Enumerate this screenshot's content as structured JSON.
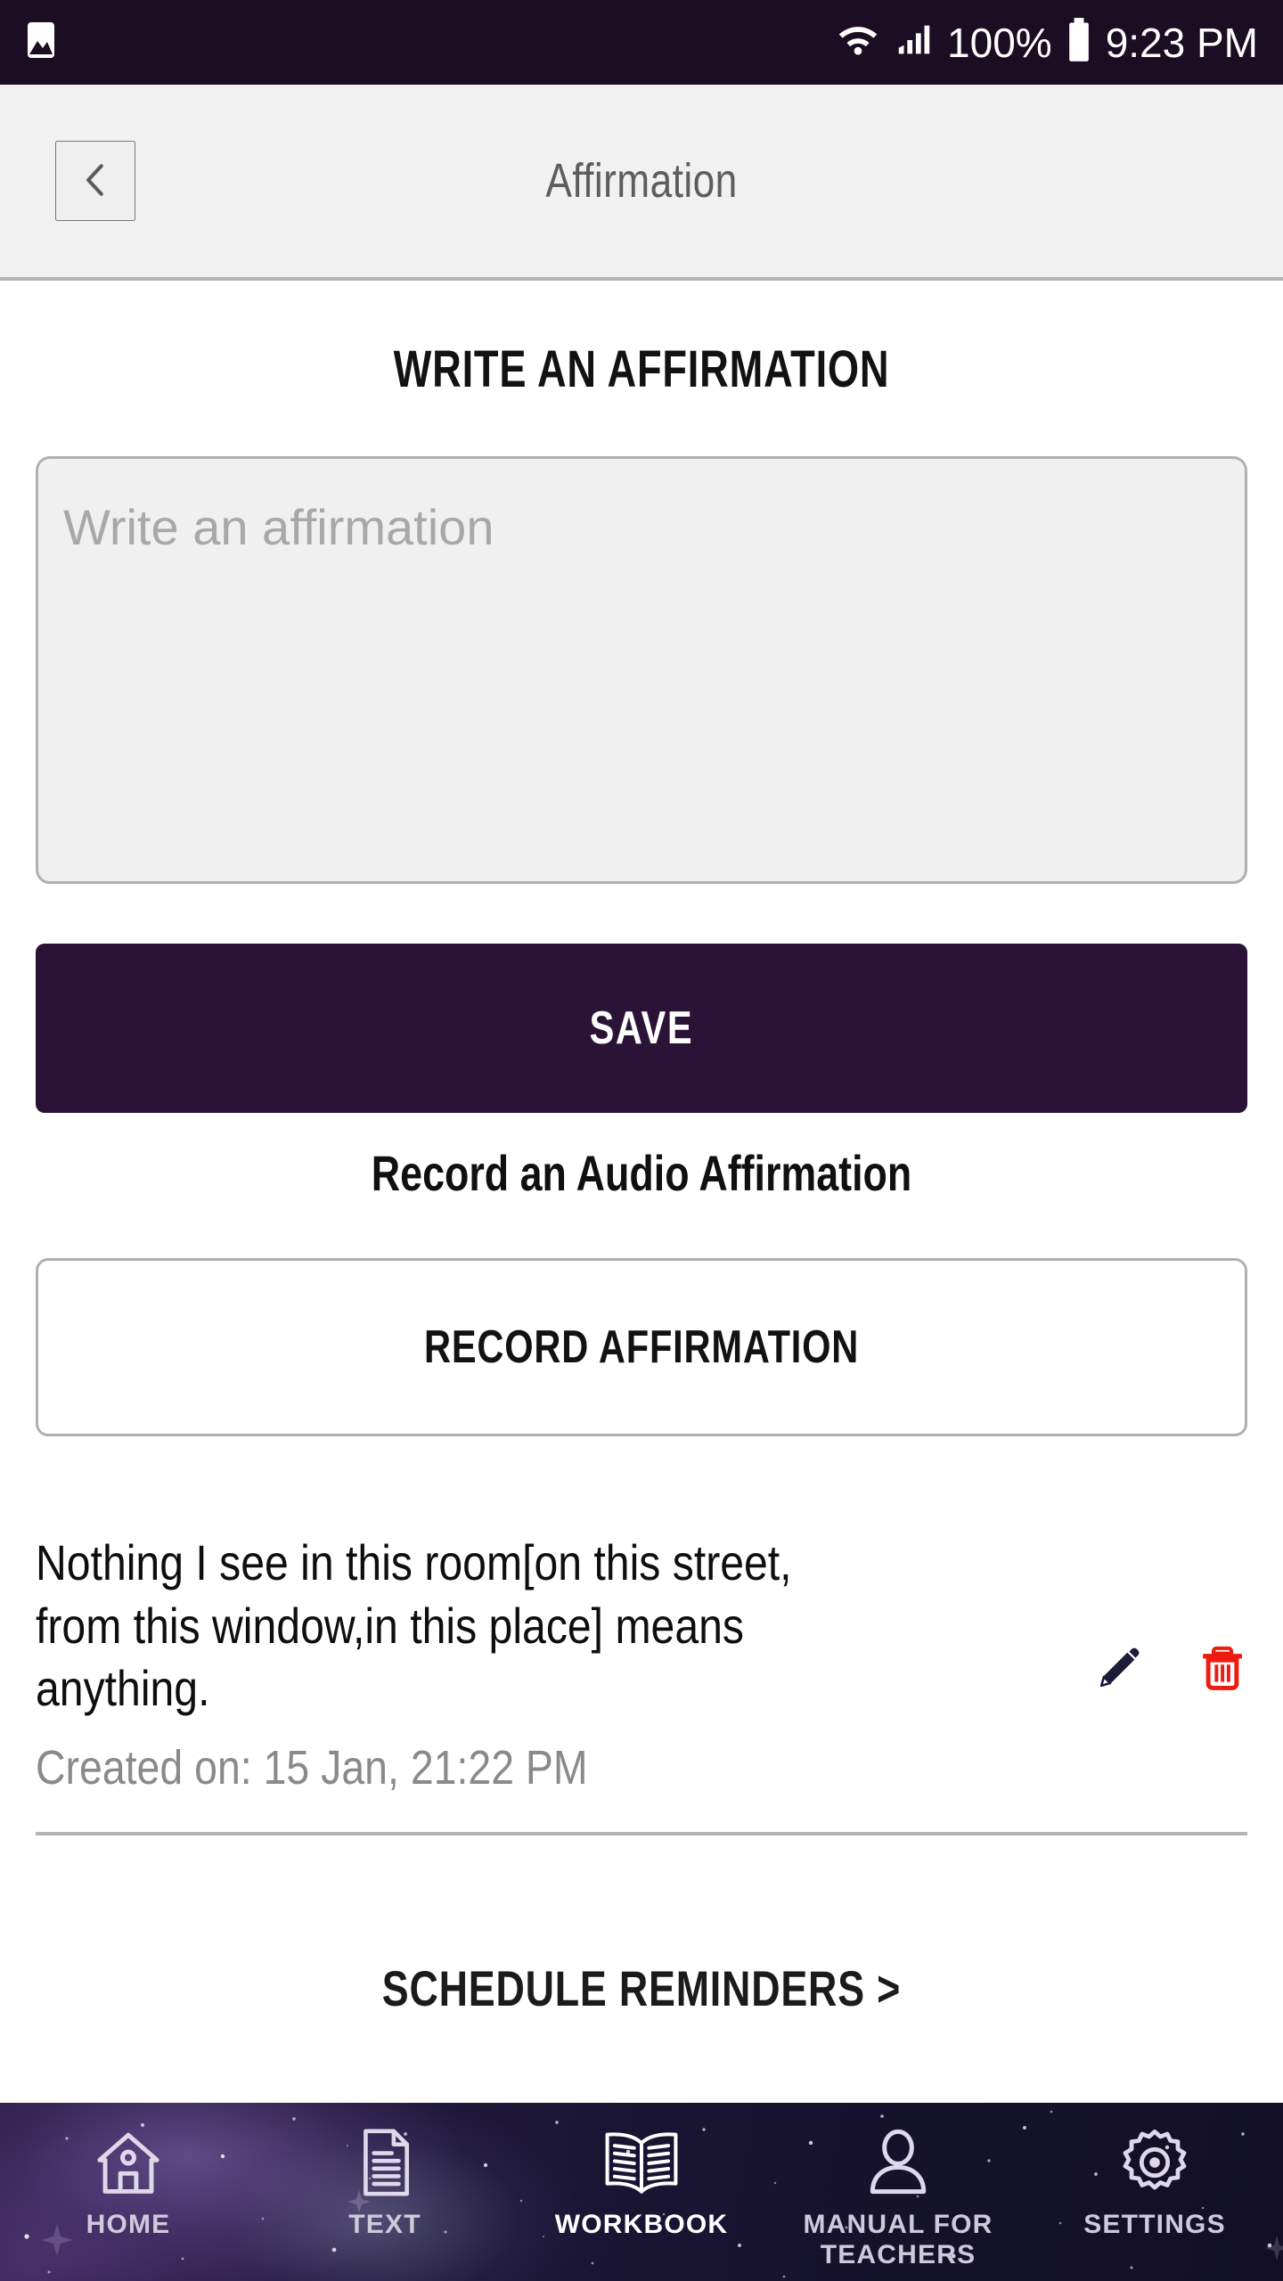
{
  "statusbar": {
    "gallery_icon": "image-icon",
    "wifi_icon": "wifi-icon",
    "signal_icon": "signal-bars-icon",
    "battery_text": "100%",
    "battery_icon": "battery-full-icon",
    "time": "9:23 PM"
  },
  "appbar": {
    "back_icon": "chevron-left-icon",
    "title": "Affirmation"
  },
  "main": {
    "section_title": "WRITE AN AFFIRMATION",
    "affirmation_input": {
      "placeholder": "Write an affirmation",
      "value": ""
    },
    "save_label": "SAVE",
    "record_prompt": "Record an Audio Affirmation",
    "record_label": "RECORD AFFIRMATION",
    "schedule_label": "SCHEDULE REMINDERS  >"
  },
  "affirmations": [
    {
      "text": "Nothing I see in this room[on this street, from this window,in this place] means anything.",
      "line1": "Nothing I see in this room[on this street,",
      "line2": "from this window,in this place] means",
      "line3": "anything.",
      "created": "Created on: 15 Jan, 21:22 PM",
      "edit_icon": "pencil-icon",
      "delete_icon": "trash-icon"
    }
  ],
  "bottomnav": {
    "items": [
      {
        "label": "HOME",
        "icon": "home-icon",
        "active": false
      },
      {
        "label": "TEXT",
        "icon": "document-icon",
        "active": false
      },
      {
        "label": "WORKBOOK",
        "icon": "open-book-icon",
        "active": true
      },
      {
        "label": "MANUAL FOR TEACHERS",
        "label_line1": "MANUAL FOR",
        "label_line2": "TEACHERS",
        "icon": "person-icon",
        "active": false
      },
      {
        "label": "SETTINGS",
        "icon": "gear-icon",
        "active": false
      }
    ]
  },
  "colors": {
    "statusbar_bg": "#1b0d22",
    "appbar_bg": "#f1f1f1",
    "primary": "#2b1338",
    "delete_red": "#ee1b11",
    "edit_navy": "#1b1b3a",
    "muted_text": "#8a8a8a"
  }
}
